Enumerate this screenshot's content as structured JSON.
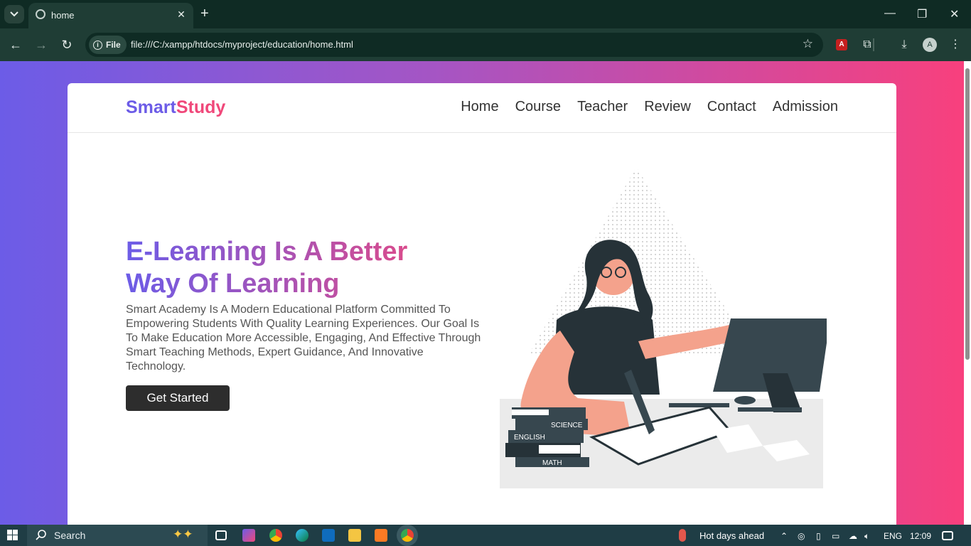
{
  "browser": {
    "tab_title": "home",
    "new_tab": "+",
    "site_info": "File",
    "url": "file:///C:/xampp/htdocs/myproject/education/home.html",
    "profile_initial": "A"
  },
  "site": {
    "logo_part1": "Smart",
    "logo_part2": "Study",
    "nav": [
      "Home",
      "Course",
      "Teacher",
      "Review",
      "Contact",
      "Admission"
    ],
    "hero_title": "E-Learning Is A Better Way Of Learning",
    "hero_text": "Smart Academy Is A Modern Educational Platform Committed To Empowering Students With Quality Learning Experiences. Our Goal Is To Make Education More Accessible, Engaging, And Effective Through Smart Teaching Methods, Expert Guidance, And Innovative Technology.",
    "cta_label": "Get Started",
    "book_labels": [
      "SCIENCE",
      "ENGLISH",
      "MATH"
    ]
  },
  "taskbar": {
    "search_label": "Search",
    "weather": "Hot days ahead",
    "language": "ENG",
    "time": "12:09"
  },
  "colors": {
    "gradient_start": "#6c5ce7",
    "gradient_end": "#f8407d",
    "logo_primary": "#6c5ce7",
    "logo_accent": "#f0487a",
    "button_bg": "#2d2d2d"
  }
}
